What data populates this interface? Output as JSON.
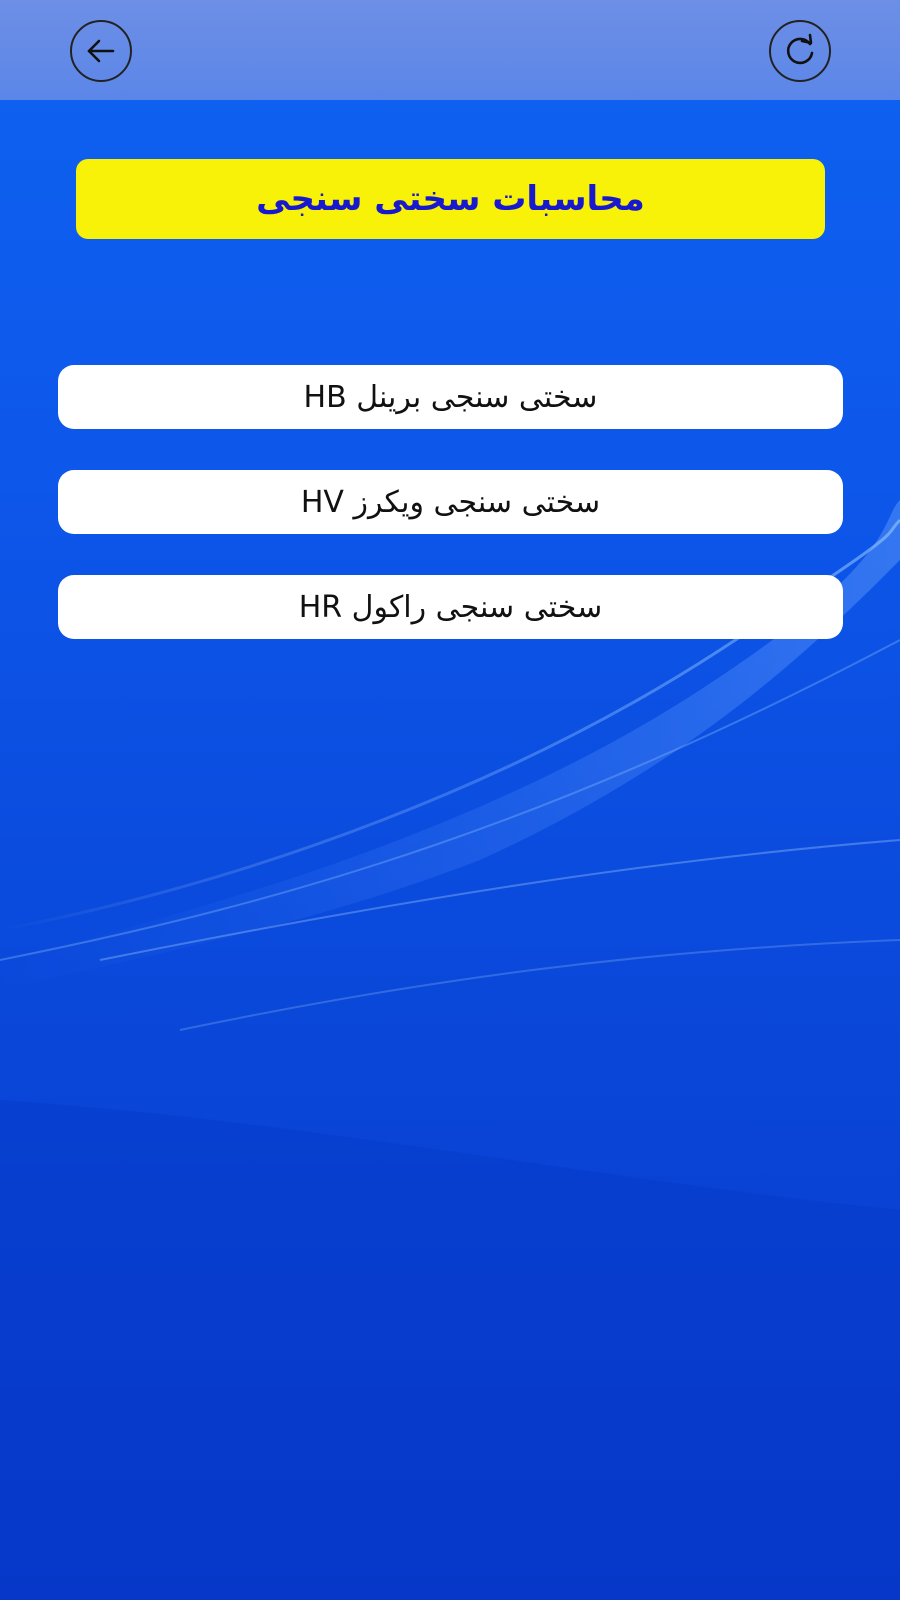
{
  "header": {
    "back_icon": "arrow-left-icon",
    "refresh_icon": "refresh-icon"
  },
  "title": "محاسبات سختی سنجی",
  "menu": [
    {
      "label": "سختی سنجی برینل HB"
    },
    {
      "label": "سختی سنجی ویکرز HV"
    },
    {
      "label": "سختی سنجی راکول HR"
    }
  ],
  "colors": {
    "background": "#0d57ea",
    "topbar": "#6d8fe6",
    "title_box": "#f7f207",
    "title_text": "#1818cf",
    "button_bg": "#ffffff"
  }
}
